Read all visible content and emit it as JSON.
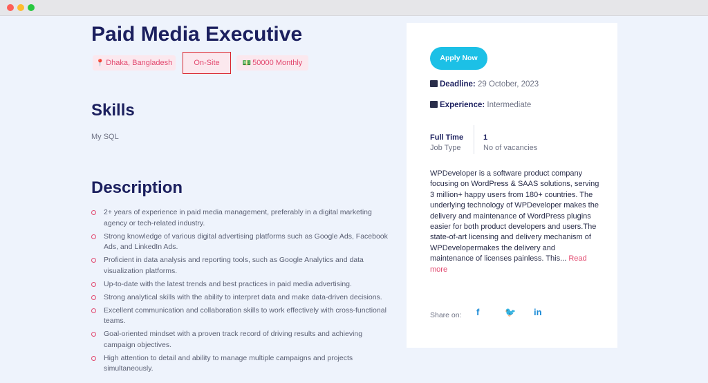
{
  "job": {
    "title": "Paid Media Executive",
    "tags": {
      "location": "Dhaka, Bangladesh",
      "work_mode": "On-Site",
      "salary": "50000 Monthly"
    }
  },
  "skills": {
    "heading": "Skills",
    "items": [
      "My SQL"
    ]
  },
  "description": {
    "heading": "Description",
    "bullets": [
      "2+ years of experience in paid media management, preferably in a digital marketing agency or tech-related industry.",
      "Strong knowledge of various digital advertising platforms such as Google Ads, Facebook Ads, and LinkedIn Ads.",
      "Proficient in data analysis and reporting tools, such as Google Analytics and data visualization platforms.",
      "Up-to-date with the latest trends and best practices in paid media advertising.",
      "Strong analytical skills with the ability to interpret data and make data-driven decisions.",
      "Excellent communication and collaboration skills to work effectively with cross-functional teams.",
      "Goal-oriented mindset with a proven track record of driving results and achieving campaign objectives.",
      "High attention to detail and ability to manage multiple campaigns and projects simultaneously."
    ]
  },
  "sidebar": {
    "apply_label": "Apply Now",
    "deadline_label": "Deadline:",
    "deadline_value": "29 October, 2023",
    "experience_label": "Experience:",
    "experience_value": "Intermediate",
    "job_type_value": "Full Time",
    "job_type_label": "Job Type",
    "vacancies_value": "1",
    "vacancies_label": "No of vacancies",
    "company_about": "WPDeveloper is a software product company focusing on WordPress & SAAS solutions, serving 3 million+ happy users from 180+ countries. The underlying technology of WPDeveloper makes the delivery and maintenance of WordPress plugins easier for both product developers and users.The state-of-art licensing and delivery mechanism of WPDevelopermakes the delivery and maintenance of licenses painless. This...",
    "read_more": "Read more",
    "share_label": "Share on:",
    "social": {
      "facebook": "f",
      "twitter": "🐦",
      "linkedin": "in"
    }
  },
  "icons": {
    "location": "map-pin-icon",
    "salary": "money-icon",
    "deadline": "calendar-icon",
    "experience": "briefcase-icon",
    "bullet": "circle-bullet-icon"
  },
  "colors": {
    "heading": "#1b1f5e",
    "accent": "#e2496f",
    "button": "#1cc0e6",
    "background": "#eef3fc"
  }
}
